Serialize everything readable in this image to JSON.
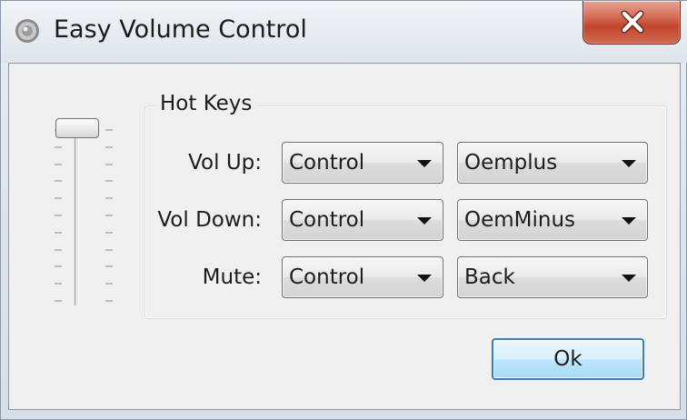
{
  "window": {
    "title": "Easy Volume Control",
    "app_icon": "speaker-icon",
    "close_icon": "close-icon"
  },
  "volume_slider": {
    "orientation": "vertical",
    "level_fraction": 1.0
  },
  "hotkeys": {
    "group_label": "Hot Keys",
    "rows": [
      {
        "label": "Vol Up:",
        "modifier": "Control",
        "key": "Oemplus"
      },
      {
        "label": "Vol Down:",
        "modifier": "Control",
        "key": "OemMinus"
      },
      {
        "label": "Mute:",
        "modifier": "Control",
        "key": "Back"
      }
    ]
  },
  "buttons": {
    "ok_label": "Ok"
  },
  "colors": {
    "close_button": "#c2452c",
    "ok_button_border": "#3c7fb1",
    "ok_button_fill": "#bee6fd"
  }
}
